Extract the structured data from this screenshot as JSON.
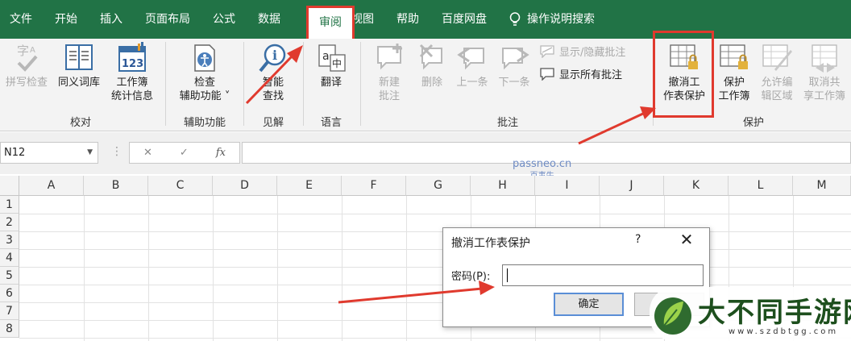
{
  "tabs": [
    "文件",
    "开始",
    "插入",
    "页面布局",
    "公式",
    "数据",
    "审阅",
    "视图",
    "帮助",
    "百度网盘"
  ],
  "active_tab": "审阅",
  "tell_me": "操作说明搜索",
  "ribbon": {
    "proofing": {
      "spelling": "拼写检查",
      "thesaurus": "同义词库",
      "workbook_stats_1": "工作簿",
      "workbook_stats_2": "统计信息",
      "label": "校对"
    },
    "accessibility": {
      "check_1": "检查",
      "check_2": "辅助功能",
      "label": "辅助功能"
    },
    "insights": {
      "smart_1": "智能",
      "smart_2": "查找",
      "label": "见解"
    },
    "language": {
      "translate": "翻译",
      "label": "语言"
    },
    "comments": {
      "new_1": "新建",
      "new_2": "批注",
      "delete": "删除",
      "previous": "上一条",
      "next": "下一条",
      "show_hide": "显示/隐藏批注",
      "show_all": "显示所有批注",
      "label": "批注"
    },
    "protect": {
      "unprotect_1": "撤消工",
      "unprotect_2": "作表保护",
      "protect_wb_1": "保护",
      "protect_wb_2": "工作簿",
      "allow_edit_1": "允许编",
      "allow_edit_2": "辑区域",
      "unshare_1": "取消共",
      "unshare_2": "享工作簿",
      "label": "保护"
    }
  },
  "formula_bar": {
    "name_box": "N12",
    "cancel_glyph": "✕",
    "enter_glyph": "✓",
    "fx_glyph": "fx",
    "value": ""
  },
  "watermark": {
    "line1": "passneo.cn",
    "line2": "百事牛"
  },
  "columns": [
    "A",
    "B",
    "C",
    "D",
    "E",
    "F",
    "G",
    "H",
    "I",
    "J",
    "K",
    "L",
    "M"
  ],
  "rows": [
    "1",
    "2",
    "3",
    "4",
    "5",
    "6",
    "7",
    "8"
  ],
  "dialog": {
    "title": "撤消工作表保护",
    "help": "?",
    "close": "✕",
    "password_label": "密码(P):",
    "password_value": "",
    "ok": "确定"
  },
  "logo": {
    "text": "大不同手游网",
    "url": "www.szdbtgg.com"
  },
  "colors": {
    "excel_green": "#217346",
    "highlight_red": "#e03a2e"
  }
}
